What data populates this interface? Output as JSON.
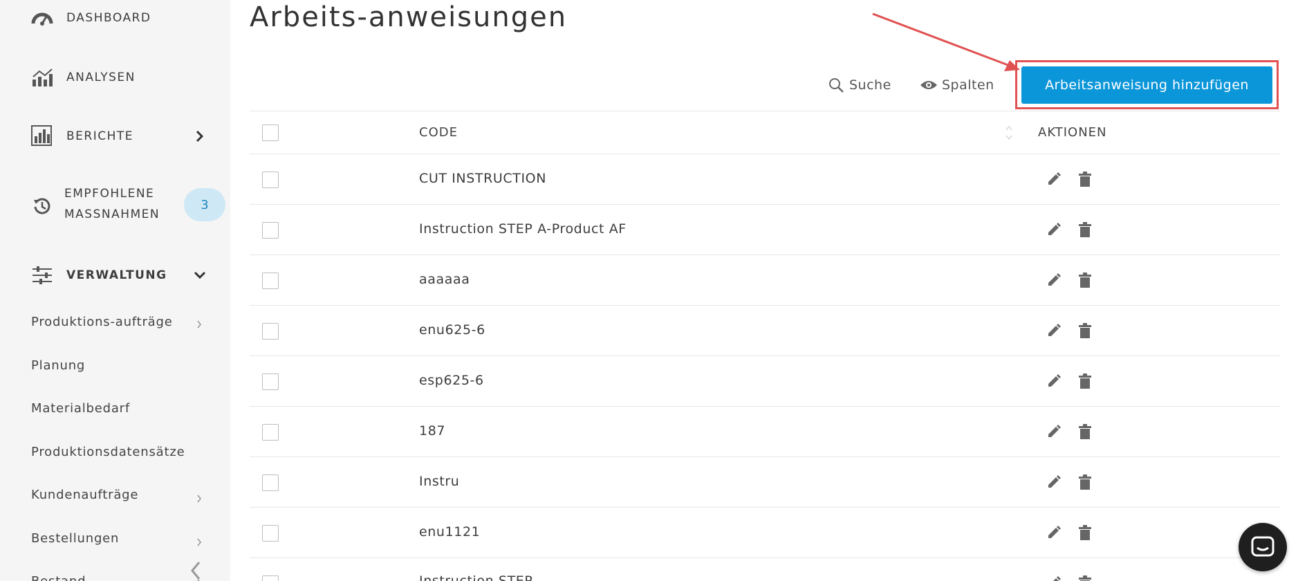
{
  "sidebar": {
    "nav": [
      {
        "label": "DASHBOARD",
        "icon": "speedometer-icon"
      },
      {
        "label": "ANALYSEN",
        "icon": "analytics-icon"
      },
      {
        "label": "BERICHTE",
        "icon": "reports-icon",
        "chevron": "chevron-right-icon"
      },
      {
        "label_line1": "EMPFOHLENE",
        "label_line2": "MASSNAHMEN",
        "icon": "history-icon",
        "badge": "3"
      },
      {
        "label": "VERWALTUNG",
        "icon": "sliders-icon",
        "chevron": "chevron-down-icon"
      }
    ],
    "submenu": [
      {
        "label": "Produktions-aufträge",
        "has_chevron": true
      },
      {
        "label": "Planung",
        "has_chevron": false
      },
      {
        "label": "Materialbedarf",
        "has_chevron": false
      },
      {
        "label": "Produktionsdatensätze",
        "has_chevron": false
      },
      {
        "label": "Kundenaufträge",
        "has_chevron": true
      },
      {
        "label": "Bestellungen",
        "has_chevron": true
      },
      {
        "label": "Bestand",
        "has_chevron": true
      }
    ],
    "badge_color": "#cfe8f5"
  },
  "main": {
    "title": "Arbeits-anweisungen",
    "toolbar": {
      "search_label": "Suche",
      "columns_label": "Spalten",
      "add_button_label": "Arbeitsanweisung hinzufügen"
    },
    "table": {
      "headers": {
        "code": "CODE",
        "actions": "AKTIONEN"
      },
      "rows": [
        {
          "code": "CUT INSTRUCTION"
        },
        {
          "code": "Instruction STEP A-Product AF"
        },
        {
          "code": "aaaaaa"
        },
        {
          "code": "enu625-6"
        },
        {
          "code": "esp625-6"
        },
        {
          "code": "187"
        },
        {
          "code": "Instru"
        },
        {
          "code": "enu1121"
        },
        {
          "code": "Instruction STEP"
        }
      ]
    }
  },
  "colors": {
    "accent": "#0c96da",
    "highlight": "#e05252",
    "sidebar_bg": "#f5f5f5"
  }
}
